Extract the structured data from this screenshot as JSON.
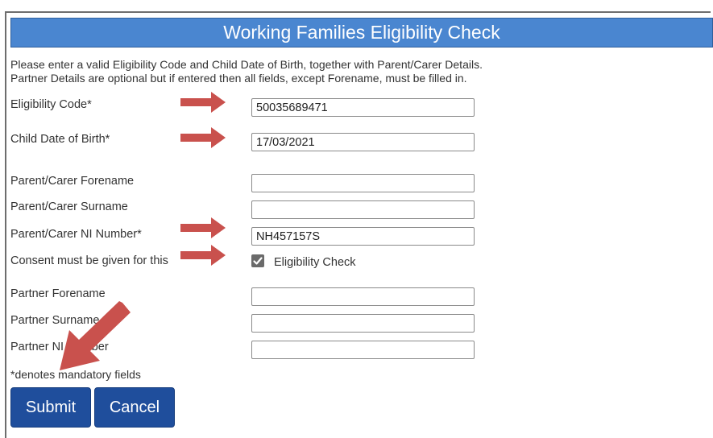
{
  "header": {
    "title": "Working Families Eligibility Check"
  },
  "intro": {
    "line1": "Please enter a valid Eligibility Code and Child Date of Birth, together with Parent/Carer Details.",
    "line2": "Partner Details are optional but if entered then all fields, except Forename, must be filled in."
  },
  "form": {
    "eligibility_code": {
      "label": "Eligibility Code*",
      "value": "50035689471"
    },
    "child_dob": {
      "label": "Child Date of Birth*",
      "value": "17/03/2021"
    },
    "parent_forename": {
      "label": "Parent/Carer Forename",
      "value": ""
    },
    "parent_surname": {
      "label": "Parent/Carer Surname",
      "value": ""
    },
    "parent_ni": {
      "label": "Parent/Carer NI Number*",
      "value": "NH457157S"
    },
    "consent": {
      "label": "Consent must be given for this",
      "checkbox_label": "Eligibility Check",
      "checked": true
    },
    "partner_forename": {
      "label": "Partner Forename",
      "value": ""
    },
    "partner_surname": {
      "label": "Partner Surname",
      "value": ""
    },
    "partner_ni": {
      "label": "Partner NI Number",
      "value": ""
    },
    "mandatory_note": "*denotes mandatory fields"
  },
  "buttons": {
    "submit": "Submit",
    "cancel": "Cancel"
  },
  "colors": {
    "header": "#4a86d0",
    "button": "#1f4e9c",
    "annotation_arrow": "#c9514d"
  }
}
